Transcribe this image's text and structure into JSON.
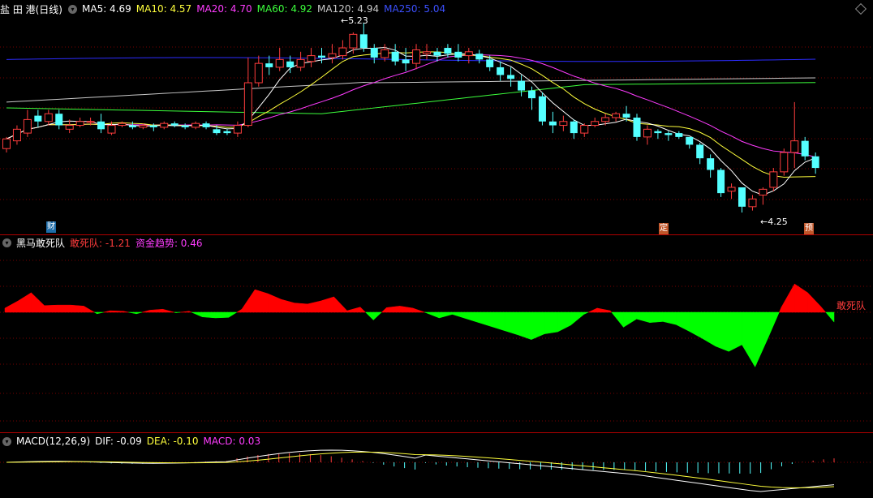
{
  "colors": {
    "up": "#ff3d3d",
    "down": "#54ffff",
    "ma5": "#ffffff",
    "ma10": "#ffff3c",
    "ma20": "#ff3cff",
    "ma60": "#3cff3c",
    "ma120": "#c8c8c8",
    "ma250": "#2c2cff",
    "red": "#ff0000",
    "green": "#00ff00",
    "dif": "#ffffff",
    "dea": "#ffff3c",
    "macd": "#ff3cff",
    "grid": "#7a0000"
  },
  "main": {
    "title": "盐 田 港(日线)",
    "toggle_icon": "chevron-down-icon",
    "ma": [
      {
        "label": "MA5: 4.69"
      },
      {
        "label": "MA10: 4.57"
      },
      {
        "label": "MA20: 4.70"
      },
      {
        "label": "MA60: 4.92"
      },
      {
        "label": "MA120: 4.94"
      },
      {
        "label": "MA250: 5.04"
      }
    ],
    "high_label": "5.23",
    "low_label": "4.25",
    "events": [
      {
        "text": "财"
      },
      {
        "text": "定"
      },
      {
        "text": "预"
      }
    ]
  },
  "indicator": {
    "title": "黑马敢死队",
    "series": [
      {
        "label": "敢死队: -1.21"
      },
      {
        "label": "资金趋势: 0.46"
      }
    ],
    "right_label": "敢死队"
  },
  "macd": {
    "title": "MACD(12,26,9)",
    "series": [
      {
        "label": "DIF: -0.09"
      },
      {
        "label": "DEA: -0.10"
      },
      {
        "label": "MACD: 0.03"
      }
    ]
  },
  "chart_data": [
    {
      "type": "candlestick",
      "title": "盐 田 港(日线)",
      "price_range": [
        4.25,
        5.23
      ],
      "latest": {
        "MA5": 4.69,
        "MA10": 4.57,
        "MA20": 4.7,
        "MA60": 4.92,
        "MA120": 4.94,
        "MA250": 5.04
      },
      "candles": [
        [
          4.58,
          4.63,
          4.56,
          4.64
        ],
        [
          4.62,
          4.68,
          4.6,
          4.7
        ],
        [
          4.66,
          4.73,
          4.64,
          4.78
        ],
        [
          4.75,
          4.72,
          4.69,
          4.78
        ],
        [
          4.72,
          4.76,
          4.7,
          4.78
        ],
        [
          4.76,
          4.7,
          4.68,
          4.78
        ],
        [
          4.68,
          4.7,
          4.66,
          4.73
        ],
        [
          4.7,
          4.72,
          4.69,
          4.74
        ],
        [
          4.72,
          4.72,
          4.7,
          4.74
        ],
        [
          4.72,
          4.68,
          4.66,
          4.76
        ],
        [
          4.66,
          4.7,
          4.65,
          4.72
        ],
        [
          4.7,
          4.71,
          4.69,
          4.72
        ],
        [
          4.7,
          4.69,
          4.68,
          4.72
        ],
        [
          4.69,
          4.7,
          4.68,
          4.71
        ],
        [
          4.7,
          4.69,
          4.67,
          4.71
        ],
        [
          4.69,
          4.71,
          4.68,
          4.72
        ],
        [
          4.71,
          4.7,
          4.69,
          4.72
        ],
        [
          4.7,
          4.69,
          4.68,
          4.71
        ],
        [
          4.69,
          4.71,
          4.68,
          4.72
        ],
        [
          4.71,
          4.69,
          4.68,
          4.72
        ],
        [
          4.68,
          4.66,
          4.65,
          4.7
        ],
        [
          4.67,
          4.66,
          4.65,
          4.68
        ],
        [
          4.66,
          4.7,
          4.64,
          4.72
        ],
        [
          4.7,
          4.92,
          4.69,
          5.05
        ],
        [
          4.92,
          5.02,
          4.9,
          5.06
        ],
        [
          5.02,
          5.0,
          4.96,
          5.06
        ],
        [
          5.0,
          5.04,
          4.98,
          5.1
        ],
        [
          5.03,
          5.0,
          4.97,
          5.06
        ],
        [
          5.0,
          5.04,
          4.98,
          5.08
        ],
        [
          5.03,
          5.06,
          5.0,
          5.1
        ],
        [
          5.06,
          5.05,
          5.02,
          5.1
        ],
        [
          5.05,
          5.07,
          5.02,
          5.12
        ],
        [
          5.06,
          5.1,
          5.04,
          5.14
        ],
        [
          5.1,
          5.17,
          5.07,
          5.18
        ],
        [
          5.17,
          5.1,
          5.08,
          5.23
        ],
        [
          5.1,
          5.05,
          5.02,
          5.12
        ],
        [
          5.05,
          5.09,
          5.03,
          5.12
        ],
        [
          5.08,
          5.03,
          5.01,
          5.12
        ],
        [
          5.04,
          5.02,
          4.98,
          5.1
        ],
        [
          5.02,
          5.09,
          4.99,
          5.12
        ],
        [
          5.07,
          5.08,
          5.04,
          5.12
        ],
        [
          5.08,
          5.06,
          5.03,
          5.1
        ],
        [
          5.1,
          5.07,
          5.05,
          5.12
        ],
        [
          5.08,
          5.05,
          5.03,
          5.12
        ],
        [
          5.06,
          5.08,
          5.02,
          5.1
        ],
        [
          5.07,
          5.04,
          5.02,
          5.09
        ],
        [
          5.04,
          5.0,
          4.98,
          5.06
        ],
        [
          5.0,
          4.96,
          4.93,
          5.03
        ],
        [
          4.96,
          4.94,
          4.9,
          5.0
        ],
        [
          4.93,
          4.88,
          4.85,
          4.96
        ],
        [
          4.88,
          4.84,
          4.78,
          4.9
        ],
        [
          4.85,
          4.72,
          4.7,
          4.87
        ],
        [
          4.72,
          4.7,
          4.66,
          4.77
        ],
        [
          4.7,
          4.72,
          4.67,
          4.75
        ],
        [
          4.72,
          4.66,
          4.63,
          4.73
        ],
        [
          4.66,
          4.7,
          4.64,
          4.71
        ],
        [
          4.7,
          4.72,
          4.69,
          4.74
        ],
        [
          4.72,
          4.74,
          4.7,
          4.76
        ],
        [
          4.74,
          4.76,
          4.72,
          4.77
        ],
        [
          4.76,
          4.74,
          4.72,
          4.8
        ],
        [
          4.74,
          4.64,
          4.62,
          4.76
        ],
        [
          4.64,
          4.68,
          4.6,
          4.7
        ],
        [
          4.67,
          4.66,
          4.63,
          4.68
        ],
        [
          4.66,
          4.65,
          4.62,
          4.67
        ],
        [
          4.66,
          4.64,
          4.63,
          4.67
        ],
        [
          4.64,
          4.6,
          4.58,
          4.64
        ],
        [
          4.6,
          4.53,
          4.5,
          4.61
        ],
        [
          4.53,
          4.47,
          4.43,
          4.55
        ],
        [
          4.47,
          4.35,
          4.33,
          4.48
        ],
        [
          4.36,
          4.38,
          4.32,
          4.4
        ],
        [
          4.38,
          4.28,
          4.25,
          4.38
        ],
        [
          4.28,
          4.32,
          4.26,
          4.34
        ],
        [
          4.34,
          4.37,
          4.29,
          4.38
        ],
        [
          4.38,
          4.46,
          4.36,
          4.48
        ],
        [
          4.46,
          4.56,
          4.44,
          4.58
        ],
        [
          4.56,
          4.62,
          4.48,
          4.82
        ],
        [
          4.62,
          4.54,
          4.52,
          4.64
        ],
        [
          4.54,
          4.48,
          4.45,
          4.56
        ]
      ]
    },
    {
      "type": "area",
      "title": "黑马敢死队",
      "series_names": [
        "敢死队",
        "资金趋势"
      ],
      "latest": {
        "敢死队": -1.21,
        "资金趋势": 0.46
      },
      "values": [
        0.8,
        2.2,
        3.8,
        1.3,
        1.4,
        1.4,
        1.2,
        -0.3,
        0.3,
        0.2,
        -0.3,
        0.4,
        0.6,
        -0.1,
        0.2,
        -0.9,
        -1.1,
        -1.0,
        0.6,
        4.4,
        3.6,
        2.5,
        1.8,
        1.6,
        2.2,
        3.0,
        0.3,
        1.0,
        -1.5,
        0.9,
        1.2,
        0.8,
        -0.1,
        -1.1,
        -0.4,
        -1.2,
        -2.0,
        -2.8,
        -3.6,
        -4.4,
        -5.3,
        -4.2,
        -3.8,
        -2.5,
        -0.4,
        0.8,
        0.3,
        -2.9,
        -1.3,
        -2.0,
        -1.8,
        -2.4,
        -3.7,
        -5.1,
        -6.6,
        -7.6,
        -6.3,
        -10.6,
        -4.9,
        1.0,
        5.5,
        3.8,
        1.1,
        -1.9
      ]
    },
    {
      "type": "line",
      "title": "MACD(12,26,9)",
      "series_names": [
        "DIF",
        "DEA",
        "MACD"
      ],
      "latest": {
        "DIF": -0.09,
        "DEA": -0.1,
        "MACD": 0.03
      }
    }
  ]
}
